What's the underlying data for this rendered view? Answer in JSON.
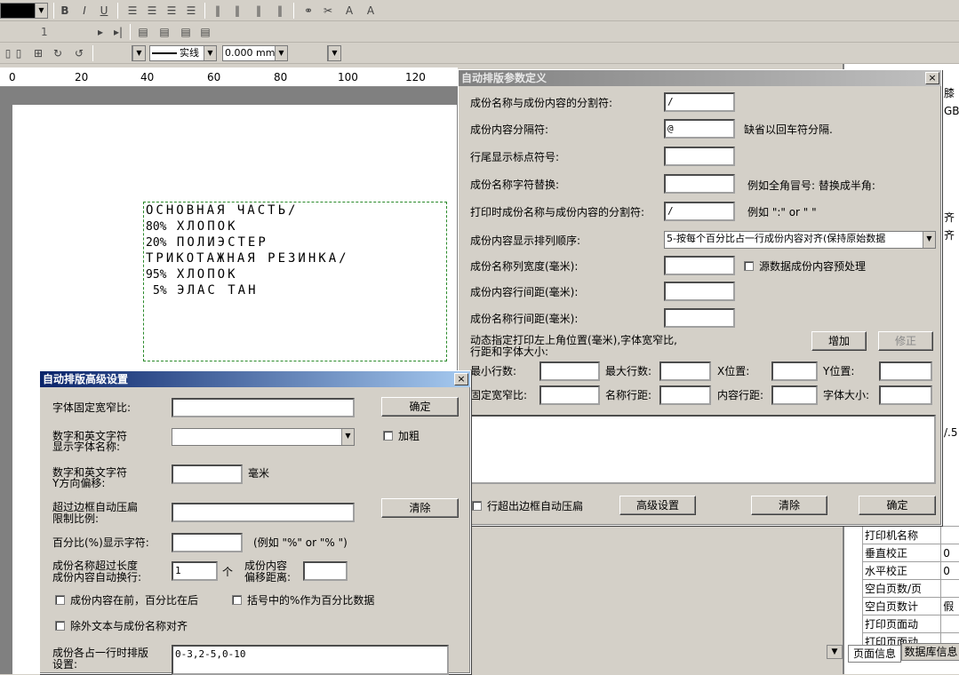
{
  "toolbar1": {
    "bold": "B",
    "italic": "I",
    "underline": "U"
  },
  "toolbar2": {
    "page_num": "1"
  },
  "toolbar3": {
    "line_style": "实线",
    "line_width": "0.000 mm"
  },
  "ruler": {
    "labels": [
      "0",
      "20",
      "40",
      "60",
      "80",
      "100",
      "120"
    ]
  },
  "label_lines": [
    {
      "pct": "",
      "text": "ОСНОВНАЯ ЧАСТЬ/"
    },
    {
      "pct": "80%",
      "text": "ХЛОПОК"
    },
    {
      "pct": "20%",
      "text": "ПОЛИЭСТЕР"
    },
    {
      "pct": "",
      "text": "ТРИКОТАЖНАЯ РЕЗИНКА/"
    },
    {
      "pct": "95%",
      "text": "ХЛОПОК"
    },
    {
      "pct": "5%",
      "text": "ЭЛАС ТАН"
    }
  ],
  "param_dialog": {
    "title": "自动排版参数定义",
    "close": "×",
    "sep_name_content_label": "成份名称与成份内容的分割符:",
    "sep_name_content_value": "/",
    "content_sep_label": "成份内容分隔符:",
    "content_sep_value": "@",
    "content_sep_hint": "缺省以回车符分隔.",
    "line_end_label": "行尾显示标点符号:",
    "line_end_value": "",
    "name_replace_label": "成份名称字符替换:",
    "name_replace_value": "",
    "name_replace_hint": "例如全角冒号: 替换成半角:",
    "print_sep_label": "打印时成份名称与成份内容的分割符:",
    "print_sep_value": "/",
    "print_sep_hint": "例如 \":\" or \" \"",
    "order_label": "成份内容显示排列顺序:",
    "order_value": "5-按每个百分比占一行成份内容对齐(保持原始数据",
    "col_width_label": "成份名称列宽度(毫米):",
    "col_width_value": "",
    "source_preprocess_label": "源数据成份内容预处理",
    "content_spacing_label": "成份内容行间距(毫米):",
    "content_spacing_value": "",
    "name_spacing_label": "成份名称行间距(毫米):",
    "name_spacing_value": "",
    "dynamic_label_1": "动态指定打印左上角位置(毫米),字体宽窄比,",
    "dynamic_label_2": "行距和字体大小:",
    "add_btn": "增加",
    "modify_btn": "修正",
    "min_rows_label": "最小行数:",
    "max_rows_label": "最大行数:",
    "x_pos_label": "X位置:",
    "y_pos_label": "Y位置:",
    "fixed_ratio_label": "固定宽窄比:",
    "name_spacing2_label": "名称行距:",
    "content_spacing2_label": "内容行距:",
    "font_size_label": "字体大小:",
    "overflow_label": "行超出边框自动压扁",
    "advanced_btn": "高级设置",
    "clear_btn": "清除",
    "ok_btn": "确定"
  },
  "adv_dialog": {
    "title": "自动排版高级设置",
    "close": "×",
    "fixed_ratio_label": "字体固定宽窄比:",
    "ok_btn": "确定",
    "font_name_label_1": "数字和英文字符",
    "font_name_label_2": "显示字体名称:",
    "bold_label": "加粗",
    "y_offset_label_1": "数字和英文字符",
    "y_offset_label_2": "Y方向偏移:",
    "unit_mm": "毫米",
    "compress_label_1": "超过边框自动压扁",
    "compress_label_2": "限制比例:",
    "clear_btn": "清除",
    "pct_char_label": "百分比(%)显示字符:",
    "pct_char_hint": "(例如 \"%\" or \"% \")",
    "wrap_label_1": "成份名称超过长度",
    "wrap_label_2": "成份内容自动换行:",
    "wrap_value": "1",
    "wrap_unit": "个",
    "offset_label_1": "成份内容",
    "offset_label_2": "偏移距离:",
    "content_first_label": "成份内容在前，百分比在后",
    "bracket_pct_label": "括号中的%作为百分比数据",
    "align_label": "除外文本与成份名称对齐",
    "layout_label_1": "成份各占一行时排版",
    "layout_label_2": "设置:",
    "layout_value": "0-3,2-5,0-10"
  },
  "right_panel": {
    "partial_1": "膝",
    "partial_2": "GB",
    "partial_3": "齐",
    "partial_4": "齐",
    "partial_5": "/.5",
    "props": [
      {
        "name": "打印机名称",
        "value": ""
      },
      {
        "name": "垂直校正",
        "value": "0"
      },
      {
        "name": "水平校正",
        "value": "0"
      },
      {
        "name": "空白页数/页",
        "value": ""
      },
      {
        "name": "空白页数计",
        "value": "假"
      },
      {
        "name": "打印页面动",
        "value": ""
      },
      {
        "name": "打印页面动",
        "value": ""
      }
    ],
    "tab_page_info": "页面信息",
    "tab_db_info": "数据库信息"
  },
  "colors": {
    "title_active": "#0a246a",
    "title_inactive": "#808080",
    "face": "#d4d0c8"
  }
}
